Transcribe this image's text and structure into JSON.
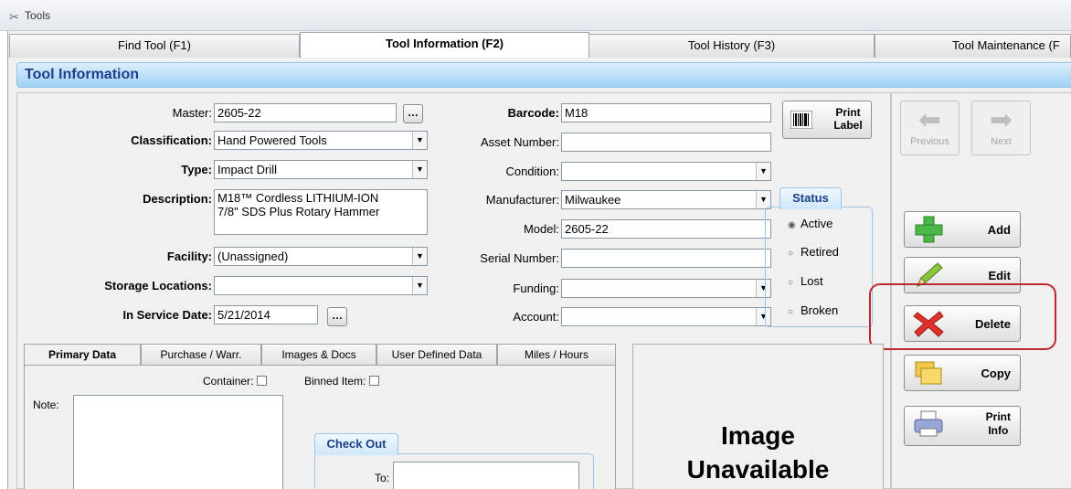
{
  "window": {
    "title": "Tools",
    "icon": "tools-icon"
  },
  "tabs": [
    {
      "label": "Find Tool (F1)"
    },
    {
      "label": "Tool Information (F2)",
      "active": true
    },
    {
      "label": "Tool History (F3)"
    },
    {
      "label": "Tool Maintenance (F"
    }
  ],
  "header": {
    "title": "Tool Information"
  },
  "left_fields": {
    "master": {
      "label": "Master:",
      "value": "2605-22"
    },
    "classification": {
      "label": "Classification:",
      "value": "Hand Powered Tools"
    },
    "type": {
      "label": "Type:",
      "value": "Impact Drill"
    },
    "description": {
      "label": "Description:",
      "line1": "M18™ Cordless LITHIUM-ION",
      "line2": "7/8\" SDS Plus Rotary Hammer"
    },
    "facility": {
      "label": "Facility:",
      "value": "(Unassigned)"
    },
    "storage": {
      "label": "Storage Locations:",
      "value": ""
    },
    "in_service": {
      "label": "In Service Date:",
      "value": "5/21/2014"
    }
  },
  "mid_fields": {
    "barcode": {
      "label": "Barcode:",
      "value": "M18"
    },
    "asset": {
      "label": "Asset Number:",
      "value": ""
    },
    "condition": {
      "label": "Condition:",
      "value": ""
    },
    "manufacturer": {
      "label": "Manufacturer:",
      "value": "Milwaukee"
    },
    "model": {
      "label": "Model:",
      "value": "2605-22"
    },
    "serial": {
      "label": "Serial Number:",
      "value": ""
    },
    "funding": {
      "label": "Funding:",
      "value": ""
    },
    "account": {
      "label": "Account:",
      "value": ""
    }
  },
  "print_label": {
    "line1": "Print",
    "line2": "Label",
    "icon": "barcode-icon"
  },
  "status": {
    "title": "Status",
    "options": [
      "Active",
      "Retired",
      "Lost",
      "Broken"
    ],
    "selected": "Active"
  },
  "nav": {
    "previous": "Previous",
    "next": "Next"
  },
  "actions": {
    "add": "Add",
    "edit": "Edit",
    "delete": "Delete",
    "copy": "Copy",
    "print_info_1": "Print",
    "print_info_2": "Info"
  },
  "subtabs": [
    "Primary Data",
    "Purchase / Warr.",
    "Images & Docs",
    "User Defined Data",
    "Miles / Hours"
  ],
  "primary": {
    "container_label": "Container:",
    "binned_label": "Binned Item:",
    "note_label": "Note:",
    "checkout_title": "Check Out",
    "to_label": "To:"
  },
  "image": {
    "line1": "Image",
    "line2": "Unavailable"
  }
}
